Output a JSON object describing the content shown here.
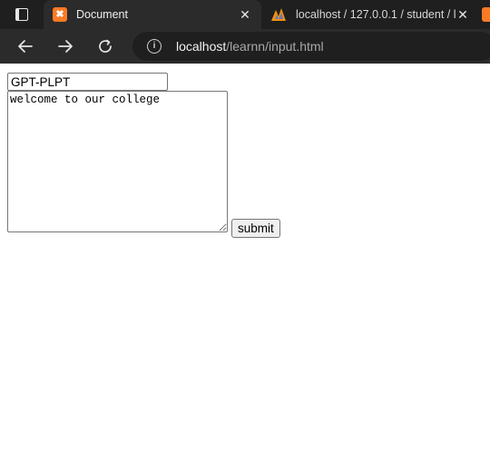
{
  "browser": {
    "tabs": [
      {
        "title": "Document",
        "favicon": "xampp-icon",
        "active": true
      },
      {
        "title": "localhost / 127.0.0.1 / student / l",
        "favicon": "phpmyadmin-icon",
        "active": false
      }
    ],
    "tab_close_glyph": "✕",
    "address": {
      "host": "localhost",
      "path": "/learnn/input.html"
    },
    "colors": {
      "favicon_orange": "#fb7a24",
      "chrome_dark": "#2b2b2b",
      "tab_strip": "#1f1f1f"
    }
  },
  "form": {
    "name_value": "GPT-PLPT",
    "message_value": "welcome to our college",
    "submit_label": "submit"
  }
}
